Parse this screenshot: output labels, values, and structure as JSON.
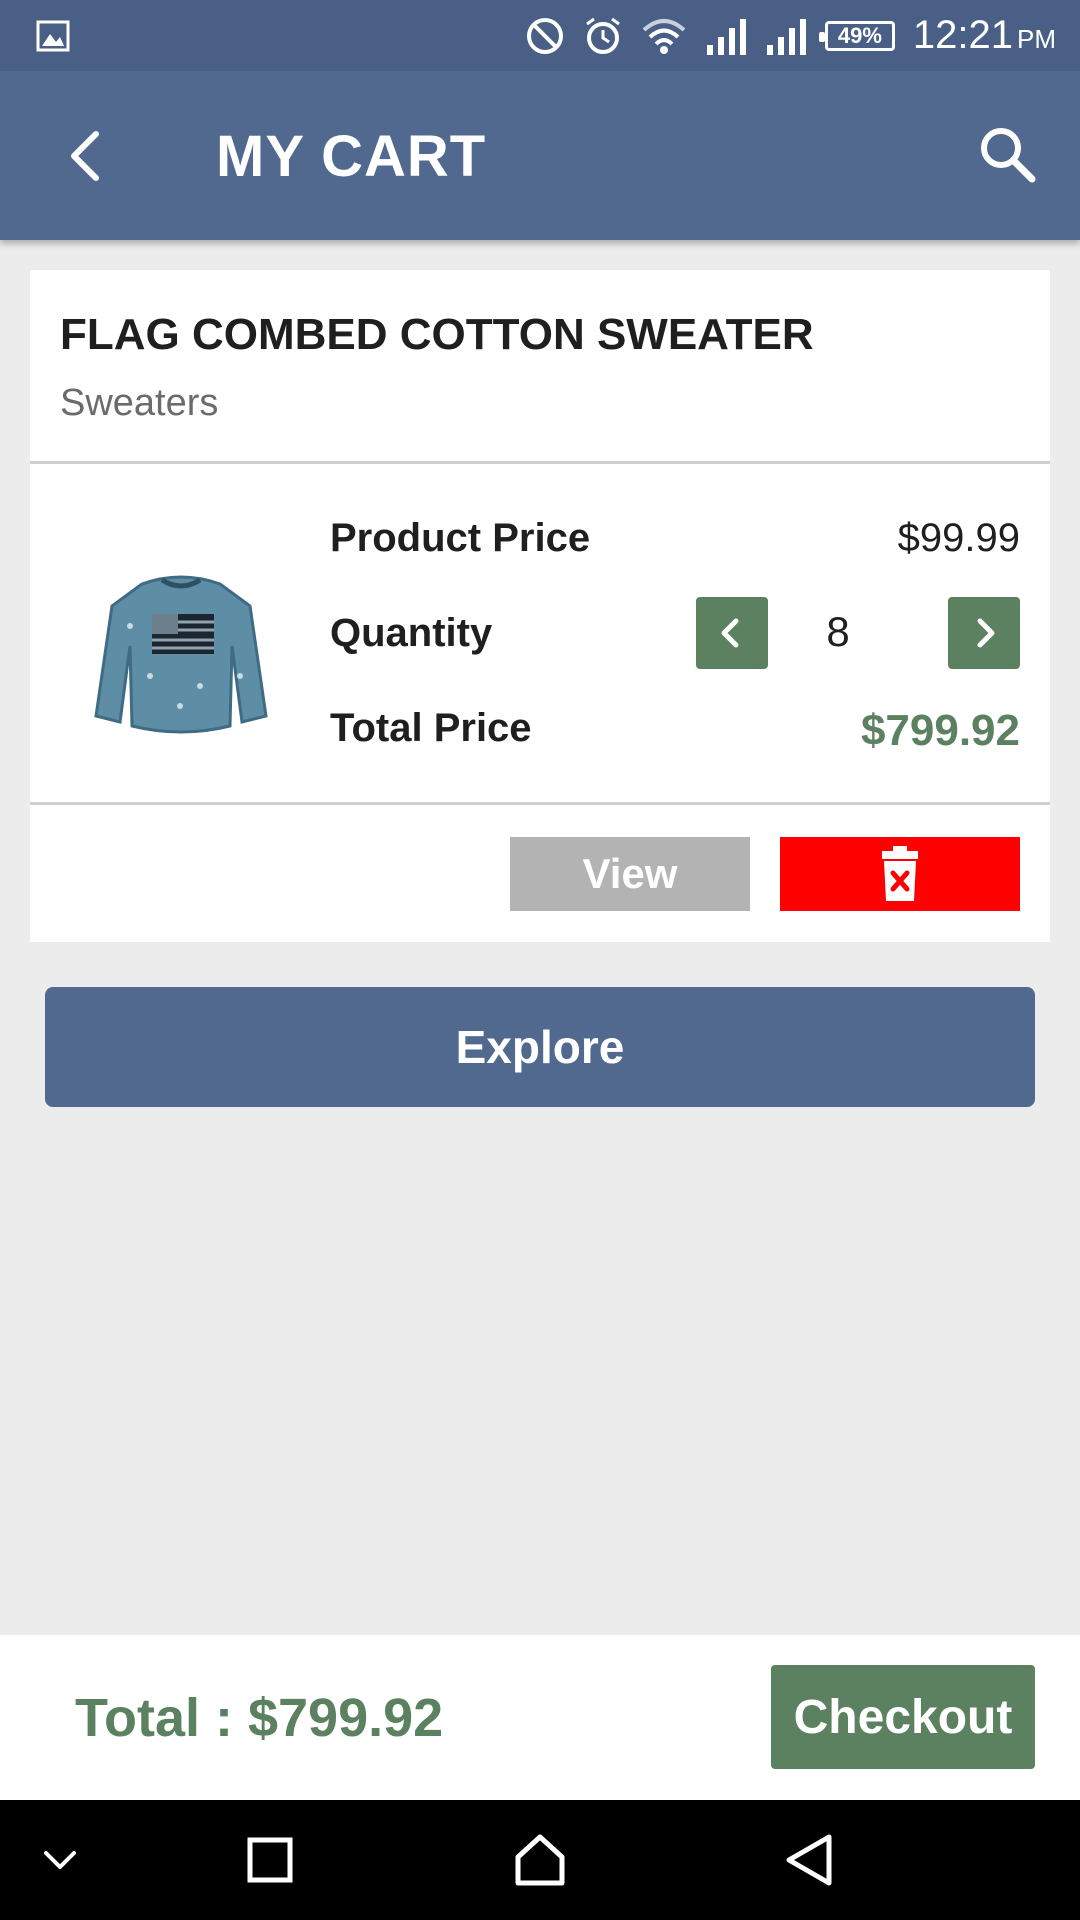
{
  "status_bar": {
    "battery": "49%",
    "time": "12:21",
    "ampm": "PM",
    "icons": [
      "gallery-icon",
      "do-not-disturb-icon",
      "alarm-icon",
      "wifi-icon",
      "signal-icon",
      "signal-icon",
      "battery-icon"
    ]
  },
  "app_bar": {
    "title": "MY CART",
    "back_icon": "chevron-left-icon",
    "search_icon": "search-icon"
  },
  "cart_item": {
    "name": "FLAG COMBED COTTON SWEATER",
    "category": "Sweaters",
    "price_label": "Product Price",
    "price": "$99.99",
    "quantity_label": "Quantity",
    "quantity": "8",
    "total_label": "Total Price",
    "total": "$799.92",
    "view_label": "View",
    "delete_icon": "trash-icon"
  },
  "explore_label": "Explore",
  "bottom_bar": {
    "total_text": "Total : $799.92",
    "checkout_label": "Checkout"
  },
  "colors": {
    "status_bar": "#4a5f85",
    "app_bar": "#51688f",
    "accent_green": "#5b8160",
    "delete_red": "#ff0000",
    "view_gray": "#b3b3b3",
    "background": "#ececec"
  }
}
